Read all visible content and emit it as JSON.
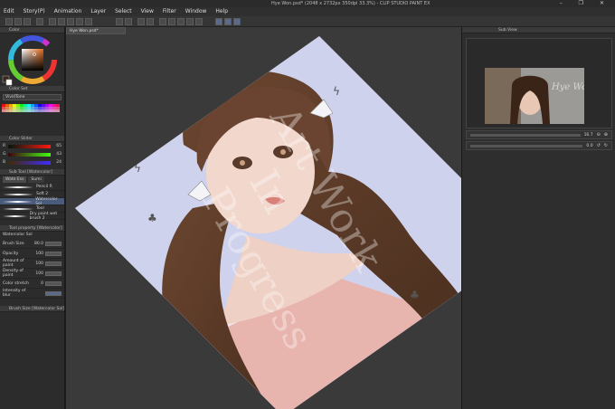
{
  "window": {
    "title": "Hye Won.psd* (2048 x 2732px 350dpi 33.3%) - CLIP STUDIO PAINT EX",
    "controls": "–  ❐  ✕"
  },
  "menu": [
    "Edit",
    "Story(P)",
    "Animation",
    "Layer",
    "Select",
    "View",
    "Filter",
    "Window",
    "Help"
  ],
  "canvas_tab": "Hye Won.psd*",
  "panels": {
    "color": {
      "title": "Color"
    },
    "color_set": {
      "title": "Color Set",
      "set_name": "VividTone"
    },
    "color_slider": {
      "title": "Color Slider",
      "channels": [
        {
          "label": "R",
          "value": "65"
        },
        {
          "label": "G",
          "value": "43"
        },
        {
          "label": "B",
          "value": "24"
        }
      ]
    },
    "subtool": {
      "title": "Sub Tool [Watercolor]",
      "tabs": [
        "Wate Ess",
        "Sumi"
      ],
      "brushes": [
        "Pencil R",
        "Soft 2",
        "Watercolor Sol",
        "Tool",
        "Dry paint wet brush 2"
      ]
    },
    "tool_property": {
      "title": "Tool property [Watercolor]",
      "current": "Watercolor Sol",
      "rows": [
        {
          "label": "Brush Size",
          "value": "80.0"
        },
        {
          "label": "Opacity",
          "value": "100"
        },
        {
          "label": "Amount of paint",
          "value": "100"
        },
        {
          "label": "Density of paint",
          "value": "100"
        },
        {
          "label": "Color stretch",
          "value": "0"
        },
        {
          "label": "Intensity of blur",
          "value": ""
        }
      ]
    },
    "brush_size": {
      "title": "Brush Size [Watercolor Sol]"
    },
    "subview": {
      "title": "Sub View",
      "zoom": "16.7",
      "rotation": "0.0"
    }
  },
  "artwork": {
    "watermark": "Art Work In Progress",
    "preview_signature": "Hye Won"
  }
}
